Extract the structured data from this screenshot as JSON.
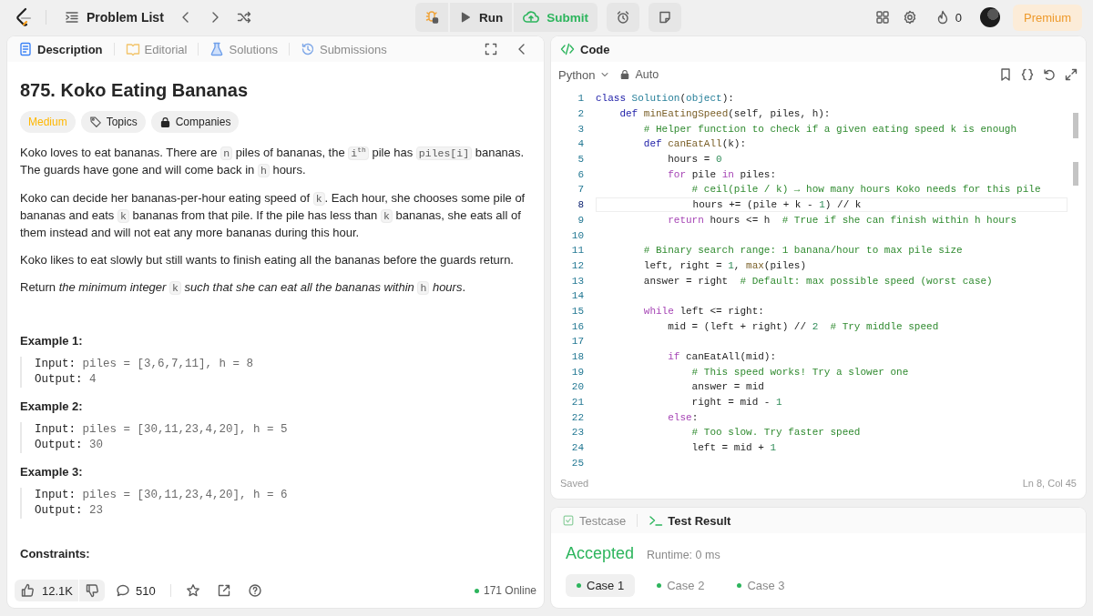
{
  "top_bar": {
    "problem_list": "Problem List",
    "run": "Run",
    "submit": "Submit",
    "streak": "0",
    "premium": "Premium"
  },
  "left_panel": {
    "tabs": [
      {
        "label": "Description",
        "selected": true
      },
      {
        "label": "Editorial",
        "selected": false
      },
      {
        "label": "Solutions",
        "selected": false
      },
      {
        "label": "Submissions",
        "selected": false
      }
    ],
    "title": "875. Koko Eating Bananas",
    "difficulty": "Medium",
    "tags": [
      "Topics",
      "Companies"
    ],
    "paragraphs": [
      [
        {
          "kind": "plain",
          "t": "Koko loves to eat bananas. There are "
        },
        {
          "kind": "code",
          "t": "n"
        },
        {
          "kind": "plain",
          "t": " piles of bananas, the "
        },
        {
          "kind": "code",
          "t": "i$^{th}$"
        },
        {
          "kind": "plain",
          "t": " pile has "
        },
        {
          "kind": "code",
          "t": "piles[i]"
        },
        {
          "kind": "plain",
          "t": " bananas. The guards have gone and will come back in "
        },
        {
          "kind": "code",
          "t": "h"
        },
        {
          "kind": "plain",
          "t": " hours."
        }
      ],
      [
        {
          "kind": "plain",
          "t": "Koko can decide her bananas-per-hour eating speed of "
        },
        {
          "kind": "code",
          "t": "k"
        },
        {
          "kind": "plain",
          "t": ". Each hour, she chooses some pile of bananas and eats "
        },
        {
          "kind": "code",
          "t": "k"
        },
        {
          "kind": "plain",
          "t": " bananas from that pile. If the pile has less than "
        },
        {
          "kind": "code",
          "t": "k"
        },
        {
          "kind": "plain",
          "t": " bananas, she eats all of them instead and will not eat any more bananas during this hour."
        }
      ],
      [
        {
          "kind": "plain",
          "t": "Koko likes to eat slowly but still wants to finish eating all the bananas before the guards return."
        }
      ],
      [
        {
          "kind": "plain",
          "t": "Return "
        },
        {
          "kind": "italic",
          "t": "the minimum integer "
        },
        {
          "kind": "code",
          "t": "k"
        },
        {
          "kind": "italic",
          "t": " such that she can eat all the bananas within "
        },
        {
          "kind": "code",
          "t": "h"
        },
        {
          "kind": "italic",
          "t": " hours"
        },
        {
          "kind": "plain",
          "t": "."
        }
      ]
    ],
    "examples": [
      {
        "title": "Example 1:",
        "lines": [
          {
            "label": "Input:",
            "value": "piles = [3,6,7,11], h = 8"
          },
          {
            "label": "Output:",
            "value": "4"
          }
        ]
      },
      {
        "title": "Example 2:",
        "lines": [
          {
            "label": "Input:",
            "value": "piles = [30,11,23,4,20], h = 5"
          },
          {
            "label": "Output:",
            "value": "30"
          }
        ]
      },
      {
        "title": "Example 3:",
        "lines": [
          {
            "label": "Input:",
            "value": "piles = [30,11,23,4,20], h = 6"
          },
          {
            "label": "Output:",
            "value": "23"
          }
        ]
      }
    ],
    "constraints_heading": "Constraints:",
    "likes": "12.1K",
    "comments": "510",
    "online": "171 Online"
  },
  "code_panel": {
    "title": "Code",
    "language": "Python",
    "mode": "Auto",
    "status": "Saved",
    "cursor": "Ln 8, Col 45",
    "lines": [
      {
        "n": "1",
        "current": false,
        "tokens": [
          {
            "kind": "kw",
            "t": "class "
          },
          {
            "kind": "cls",
            "t": "Solution"
          },
          {
            "kind": "pl",
            "t": "("
          },
          {
            "kind": "cls",
            "t": "object"
          },
          {
            "kind": "pl",
            "t": "):"
          }
        ]
      },
      {
        "n": "2",
        "current": false,
        "tokens": [
          {
            "kind": "kw",
            "t": "    def "
          },
          {
            "kind": "fn",
            "t": "minEatingSpeed"
          },
          {
            "kind": "pl",
            "t": "(self, piles, h):"
          }
        ]
      },
      {
        "n": "3",
        "current": false,
        "tokens": [
          {
            "kind": "cm",
            "t": "        # Helper function to check if a given eating speed k is enough"
          }
        ]
      },
      {
        "n": "4",
        "current": false,
        "tokens": [
          {
            "kind": "kw",
            "t": "        def "
          },
          {
            "kind": "fn",
            "t": "canEatAll"
          },
          {
            "kind": "pl",
            "t": "(k):"
          }
        ]
      },
      {
        "n": "5",
        "current": false,
        "tokens": [
          {
            "kind": "pl",
            "t": "            hours = "
          },
          {
            "kind": "num",
            "t": "0"
          }
        ]
      },
      {
        "n": "6",
        "current": false,
        "tokens": [
          {
            "kind": "ctl",
            "t": "            for"
          },
          {
            "kind": "pl",
            "t": " pile "
          },
          {
            "kind": "ctl",
            "t": "in"
          },
          {
            "kind": "pl",
            "t": " piles:"
          }
        ]
      },
      {
        "n": "7",
        "current": false,
        "tokens": [
          {
            "kind": "cm",
            "t": "                # ceil(pile / k) → how many hours Koko needs for this pile"
          }
        ]
      },
      {
        "n": "8",
        "current": true,
        "tokens": [
          {
            "kind": "pl",
            "t": "                hours += (pile + k - "
          },
          {
            "kind": "num",
            "t": "1"
          },
          {
            "kind": "pl",
            "t": ") // k"
          }
        ]
      },
      {
        "n": "9",
        "current": false,
        "tokens": [
          {
            "kind": "ctl",
            "t": "            return"
          },
          {
            "kind": "pl",
            "t": " hours <= h  "
          },
          {
            "kind": "cm",
            "t": "# True if she can finish within h hours"
          }
        ]
      },
      {
        "n": "10",
        "current": false
      },
      {
        "n": "11",
        "current": false,
        "tokens": [
          {
            "kind": "cm",
            "t": "        # Binary search range: 1 banana/hour to max pile size"
          }
        ]
      },
      {
        "n": "12",
        "current": false,
        "tokens": [
          {
            "kind": "pl",
            "t": "        left, right = "
          },
          {
            "kind": "num",
            "t": "1"
          },
          {
            "kind": "pl",
            "t": ", "
          },
          {
            "kind": "fn",
            "t": "max"
          },
          {
            "kind": "pl",
            "t": "(piles)"
          }
        ]
      },
      {
        "n": "13",
        "current": false,
        "tokens": [
          {
            "kind": "pl",
            "t": "        answer = right  "
          },
          {
            "kind": "cm",
            "t": "# Default: max possible speed (worst case)"
          }
        ]
      },
      {
        "n": "14",
        "current": false
      },
      {
        "n": "15",
        "current": false,
        "tokens": [
          {
            "kind": "ctl",
            "t": "        while"
          },
          {
            "kind": "pl",
            "t": " left <= right:"
          }
        ]
      },
      {
        "n": "16",
        "current": false,
        "tokens": [
          {
            "kind": "pl",
            "t": "            mid = (left + right) // "
          },
          {
            "kind": "num",
            "t": "2"
          },
          {
            "kind": "cm",
            "t": "  # Try middle speed"
          }
        ]
      },
      {
        "n": "17",
        "current": false
      },
      {
        "n": "18",
        "current": false,
        "tokens": [
          {
            "kind": "ctl",
            "t": "            if"
          },
          {
            "kind": "pl",
            "t": " canEatAll(mid):"
          }
        ]
      },
      {
        "n": "19",
        "current": false,
        "tokens": [
          {
            "kind": "cm",
            "t": "                # This speed works! Try a slower one"
          }
        ]
      },
      {
        "n": "20",
        "current": false,
        "tokens": [
          {
            "kind": "pl",
            "t": "                answer = mid"
          }
        ]
      },
      {
        "n": "21",
        "current": false,
        "tokens": [
          {
            "kind": "pl",
            "t": "                right = mid - "
          },
          {
            "kind": "num",
            "t": "1"
          }
        ]
      },
      {
        "n": "22",
        "current": false,
        "tokens": [
          {
            "kind": "ctl",
            "t": "            else"
          },
          {
            "kind": "pl",
            "t": ":"
          }
        ]
      },
      {
        "n": "23",
        "current": false,
        "tokens": [
          {
            "kind": "cm",
            "t": "                # Too slow. Try faster speed"
          }
        ]
      },
      {
        "n": "24",
        "current": false,
        "tokens": [
          {
            "kind": "pl",
            "t": "                left = mid + "
          },
          {
            "kind": "num",
            "t": "1"
          }
        ]
      },
      {
        "n": "25",
        "current": false
      }
    ]
  },
  "test_panel": {
    "tabs": [
      {
        "label": "Testcase",
        "selected": false
      },
      {
        "label": "Test Result",
        "selected": true
      }
    ],
    "verdict": "Accepted",
    "runtime": "Runtime: 0 ms",
    "cases": [
      {
        "label": "Case 1",
        "selected": true
      },
      {
        "label": "Case 2",
        "selected": false
      },
      {
        "label": "Case 3",
        "selected": false
      }
    ]
  }
}
